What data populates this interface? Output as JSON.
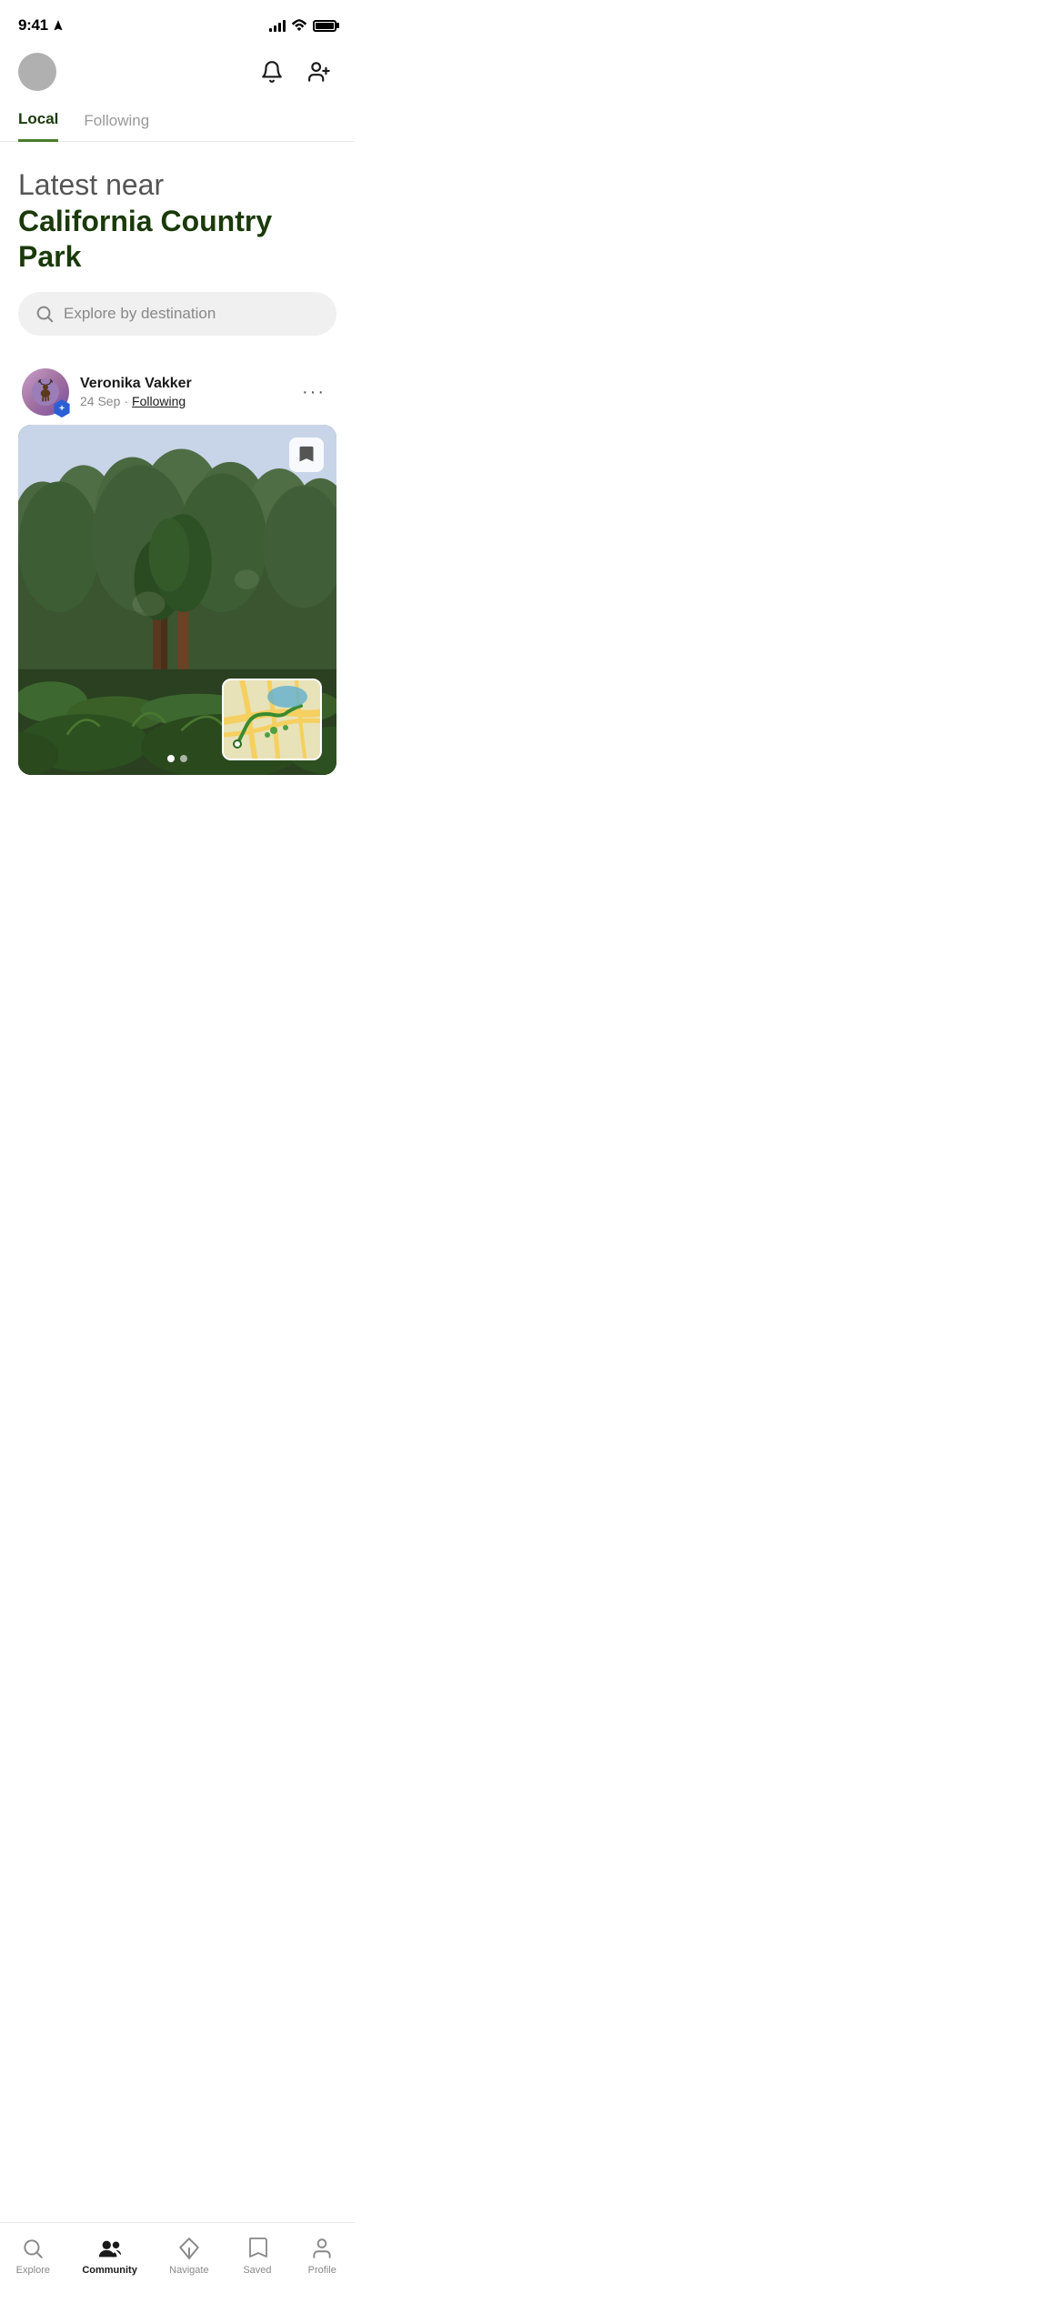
{
  "statusBar": {
    "time": "9:41",
    "hasLocation": true
  },
  "header": {
    "notificationIcon": "bell",
    "addUserIcon": "person-add"
  },
  "tabs": [
    {
      "id": "local",
      "label": "Local",
      "active": true
    },
    {
      "id": "following",
      "label": "Following",
      "active": false
    }
  ],
  "hero": {
    "prefix": "Latest near",
    "locationName": "California Country Park"
  },
  "search": {
    "placeholder": "Explore by destination"
  },
  "post": {
    "author": {
      "name": "Veronika Vakker",
      "date": "24 Sep",
      "followLabel": "Following"
    }
  },
  "pagination": {
    "total": 2,
    "current": 0
  },
  "bottomNav": [
    {
      "id": "explore",
      "label": "Explore",
      "active": false,
      "icon": "search"
    },
    {
      "id": "community",
      "label": "Community",
      "active": true,
      "icon": "people"
    },
    {
      "id": "navigate",
      "label": "Navigate",
      "active": false,
      "icon": "navigate"
    },
    {
      "id": "saved",
      "label": "Saved",
      "active": false,
      "icon": "bookmark"
    },
    {
      "id": "profile",
      "label": "Profile",
      "active": false,
      "icon": "person"
    }
  ]
}
